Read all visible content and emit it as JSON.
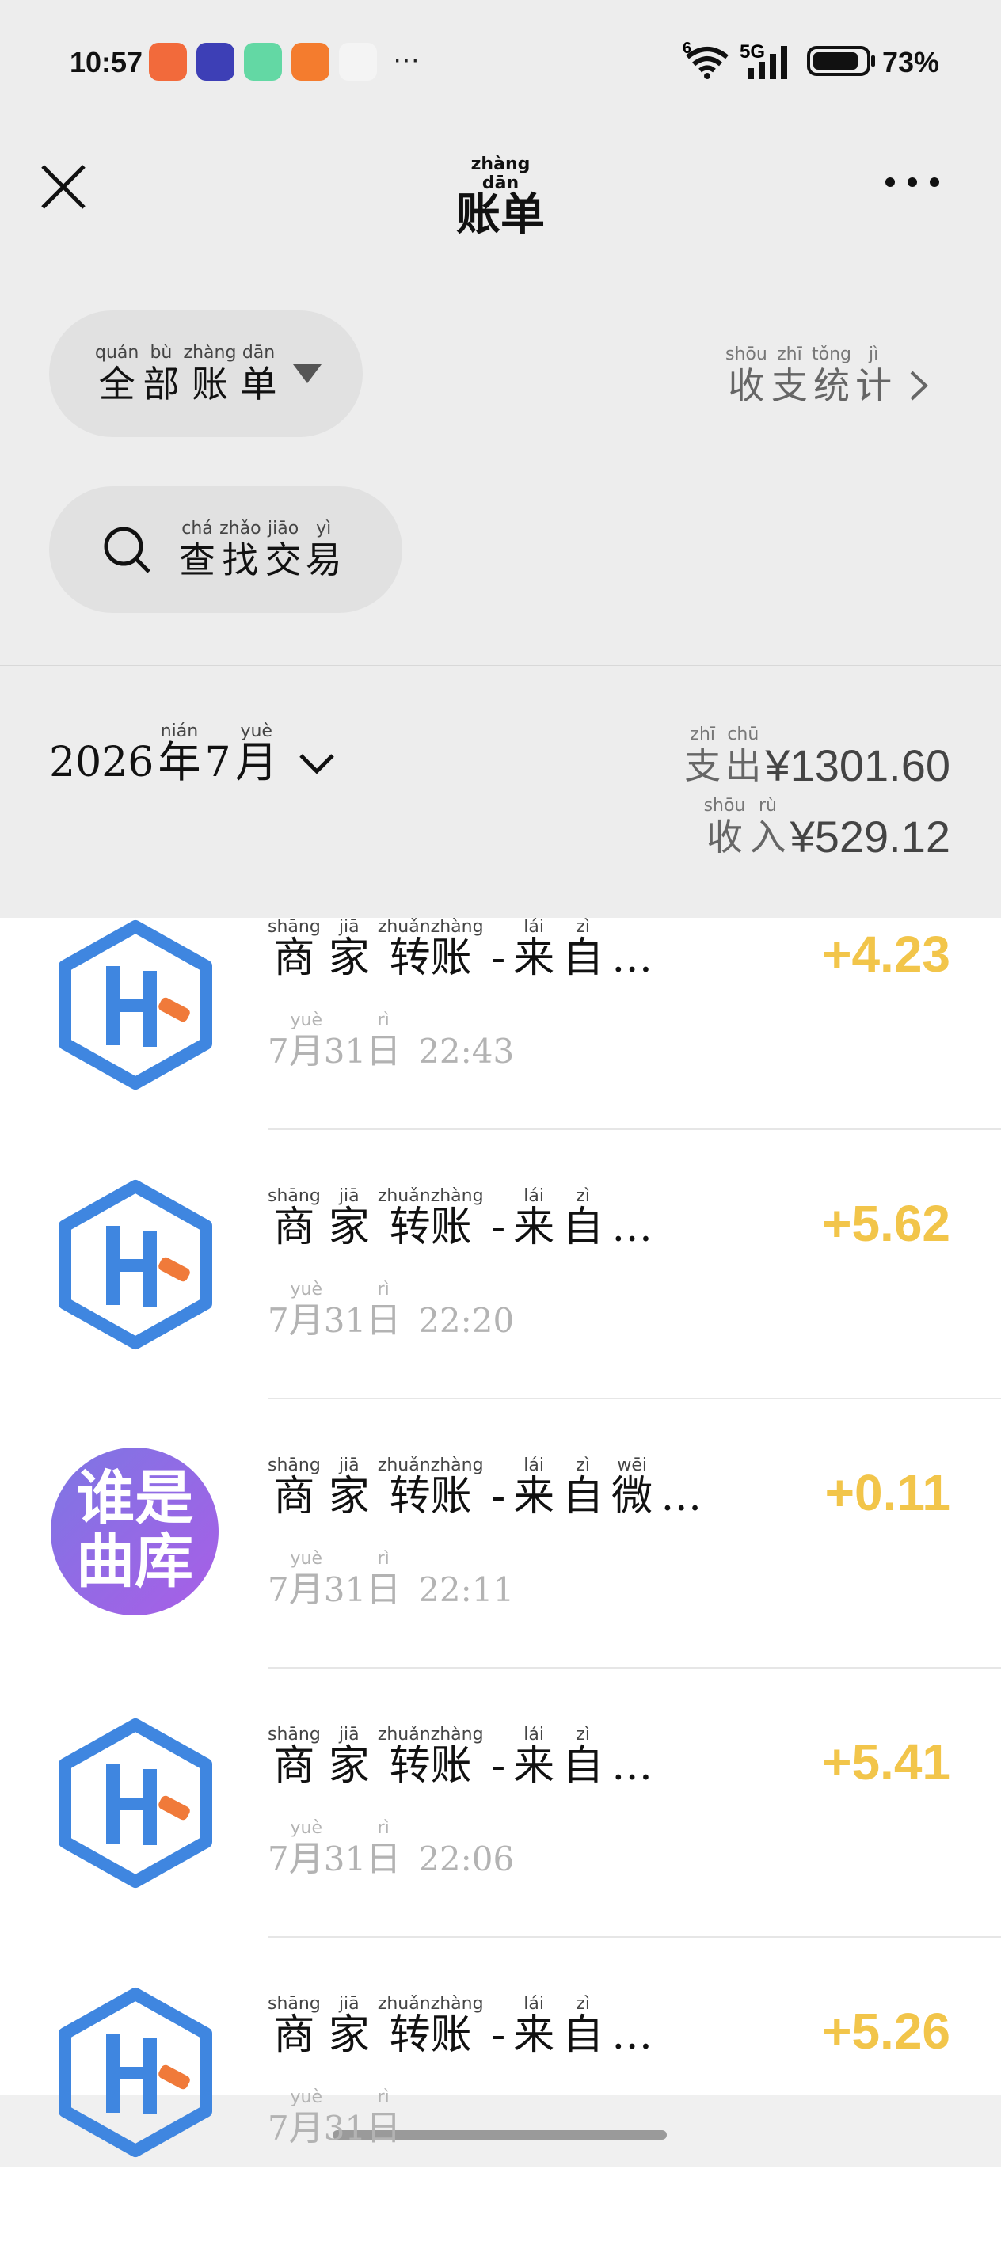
{
  "status_bar": {
    "time": "10:57",
    "network": "5G",
    "wifi_badge": "6",
    "battery": "73%",
    "overflow": "···",
    "app_icons": [
      "app-icon-orange-grid",
      "app-icon-tieba",
      "app-icon-green-chat",
      "app-icon-orange-person",
      "app-icon-blue-planet"
    ]
  },
  "header": {
    "title_hz": "账单",
    "title_py": "zhàng dān",
    "filter": {
      "py": [
        "quán",
        "bù",
        "zhàng",
        "dān"
      ],
      "hz": [
        "全",
        "部",
        "账",
        "单"
      ]
    },
    "search": {
      "py": [
        "chá",
        "zhǎo",
        "jiāo",
        "yì"
      ],
      "hz": [
        "查",
        "找",
        "交",
        "易"
      ]
    },
    "stats": {
      "py": [
        "shōu",
        "zhī",
        "tǒng",
        "jì"
      ],
      "hz": [
        "收",
        "支",
        "统",
        "计"
      ]
    }
  },
  "summary": {
    "year": "2026",
    "month": "7",
    "nian_py": "nián",
    "nian_hz": "年",
    "yue_py": "yuè",
    "yue_hz": "月",
    "expense_label_py": [
      "zhī",
      "chū"
    ],
    "expense_label_hz": [
      "支",
      "出"
    ],
    "expense_value": "¥1301.60",
    "income_label_py": [
      "shōu",
      "rù"
    ],
    "income_label_hz": [
      "收",
      "入"
    ],
    "income_value": "¥529.12"
  },
  "transactions": [
    {
      "name_py": [
        "shāng",
        "jiā",
        "zhuǎnzhàng",
        "",
        "lái",
        "zì",
        ""
      ],
      "name_hz": [
        "商",
        "家",
        "转账",
        "-",
        "来",
        "自",
        "…"
      ],
      "month": "7",
      "day": "31",
      "clock": "22:43",
      "amount": "+4.23",
      "logo": "hexagon-logo"
    },
    {
      "name_py": [
        "shāng",
        "jiā",
        "zhuǎnzhàng",
        "",
        "lái",
        "zì",
        ""
      ],
      "name_hz": [
        "商",
        "家",
        "转账",
        "-",
        "来",
        "自",
        "…"
      ],
      "month": "7",
      "day": "31",
      "clock": "22:20",
      "amount": "+5.62",
      "logo": "hexagon-logo"
    },
    {
      "name_py": [
        "shāng",
        "jiā",
        "zhuǎnzhàng",
        "",
        "lái",
        "zì",
        "wēi",
        ""
      ],
      "name_hz": [
        "商",
        "家",
        "转账",
        "-",
        "来",
        "自",
        "微",
        "…"
      ],
      "month": "7",
      "day": "31",
      "clock": "22:11",
      "amount": "+0.11",
      "logo": "quku-logo",
      "logo_text": "谁是曲库"
    },
    {
      "name_py": [
        "shāng",
        "jiā",
        "zhuǎnzhàng",
        "",
        "lái",
        "zì",
        ""
      ],
      "name_hz": [
        "商",
        "家",
        "转账",
        "-",
        "来",
        "自",
        "…"
      ],
      "month": "7",
      "day": "31",
      "clock": "22:06",
      "amount": "+5.41",
      "logo": "hexagon-logo"
    },
    {
      "name_py": [
        "shāng",
        "jiā",
        "zhuǎnzhàng",
        "",
        "lái",
        "zì",
        ""
      ],
      "name_hz": [
        "商",
        "家",
        "转账",
        "-",
        "来",
        "自",
        "…"
      ],
      "month": "7",
      "day": "31",
      "clock": "",
      "amount": "+5.26",
      "logo": "hexagon-logo"
    }
  ],
  "date_labels": {
    "yue_py": "yuè",
    "yue_hz": "月",
    "ri_py": "rì",
    "ri_hz": "日"
  },
  "colors": {
    "income": "#f2c54a",
    "hex_logo": "#3f86e0",
    "hex_accent": "#f07a3a",
    "header_bg": "#ededed"
  }
}
